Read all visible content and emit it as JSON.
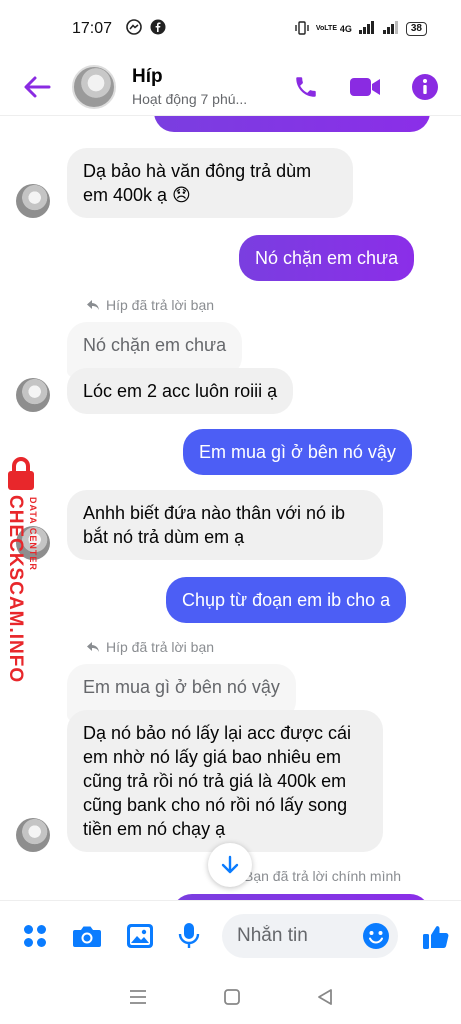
{
  "status_bar": {
    "time": "17:07",
    "network": "4G",
    "volte": "VoLTE",
    "battery": "38"
  },
  "header": {
    "name": "Híp",
    "status": "Hoạt động 7 phú..."
  },
  "messages": {
    "m1": "Dạ bảo hà văn đông trả dùm em 400k ạ 😞",
    "m2": "Nó chặn em chưa",
    "reply1_label": "Híp đã trả lời bạn",
    "reply1_quote": "Nó chặn em chưa",
    "m3": "Lóc em 2 acc luôn roiii ạ",
    "m4": "Em mua gì ở bên nó vậy",
    "m5": "Anhh biết đứa nào thân với nó ib bắt nó trả dùm em ạ",
    "m6": "Chụp từ đoạn em ib cho a",
    "reply2_label": "Híp đã trả lời bạn",
    "reply2_quote": "Em mua gì ở bên nó vậy",
    "m7": "Dạ nó bảo nó lấy lại acc được cái em nhờ nó lấy giá bao nhiêu em cũng trả rồi nó trả giá là 400k em cũng bank cho nó rồi nó lấy song tiền em nó chạy ạ",
    "reply3_label": "Bạn đã trả lời chính mình"
  },
  "composer": {
    "placeholder": "Nhắn tin"
  },
  "watermark": {
    "main": "CHECKSCAM.INFO",
    "sub": "DATA CENTER"
  },
  "colors": {
    "accent": "#8a2be2",
    "out_purple": "#8033e6",
    "out_blue": "#4c5ef5",
    "icon_blue": "#0a7cff",
    "incoming": "#f0f0f0"
  },
  "icons": {
    "back": "arrow-left-icon",
    "call": "phone-icon",
    "video": "video-camera-icon",
    "info": "info-icon",
    "menu": "grid-dots-icon",
    "camera": "camera-icon",
    "gallery": "image-icon",
    "mic": "microphone-icon",
    "emoji": "smiley-icon",
    "like": "thumbs-up-icon",
    "scroll": "arrow-down-icon"
  }
}
